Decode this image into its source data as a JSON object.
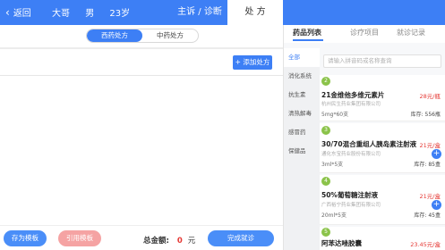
{
  "header": {
    "back_label": "返回",
    "patient_name": "大哥",
    "patient_sex": "男",
    "patient_age": "23岁",
    "tab_diagnosis": "主诉 / 诊断",
    "tab_prescription": "处 方"
  },
  "left": {
    "segment_western": "西药处方",
    "segment_chinese": "中药处方",
    "add_prescription": "+ 添加处方",
    "save_template": "存为模板",
    "cite_template": "引用模板",
    "total_label": "总金额:",
    "total_amount": "0",
    "total_unit": "元",
    "finish_button": "完成就诊"
  },
  "right": {
    "tabs": [
      "药品列表",
      "诊疗项目",
      "就诊记录"
    ],
    "categories": [
      "全部",
      "消化系统",
      "抗生素",
      "清热解毒",
      "感冒药",
      "保健品"
    ],
    "search_placeholder": "请输入拼音码或名称查询",
    "drugs": [
      {
        "badge": "2",
        "name": "21金维他多维元素片",
        "price": "28元/瓶",
        "maker": "杭州民生药业集团有限公司",
        "spec": "5mg*60支",
        "stock": "库存: 556瓶"
      },
      {
        "badge": "3",
        "name": "30/70混合重组人胰岛素注射液",
        "price": "21元/盒",
        "maker": "通化东宝药业股份有限公司",
        "spec": "3ml*5支",
        "stock": "库存: 85盒"
      },
      {
        "badge": "4",
        "name": "50%葡萄糖注射液",
        "price": "21元/盒",
        "maker": "广西裕宁药业集团有限公司",
        "spec": "20ml*5支",
        "stock": "库存: 45盒"
      },
      {
        "badge": "5",
        "name": "阿苯达唑胶囊",
        "price": "23.45元/盒",
        "maker": "",
        "spec": "",
        "stock": ""
      }
    ]
  },
  "colors": {
    "primary": "#3d7ff5",
    "badge": "#8bc34a",
    "price": "#e53935",
    "cite_button": "#f5a3a3"
  }
}
